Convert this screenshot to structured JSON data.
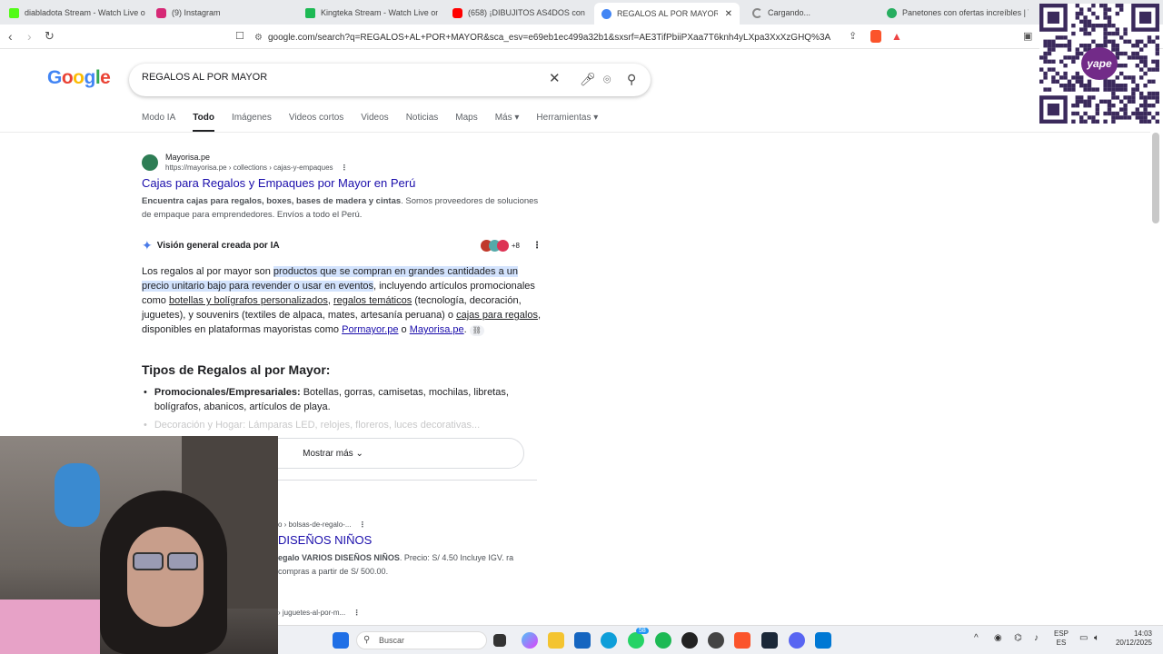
{
  "browser": {
    "tabs": [
      {
        "label": "diabladota Stream - Watch Live on Ki"
      },
      {
        "label": "(9) Instagram"
      },
      {
        "label": "Kingteka Stream - Watch Live on Kic"
      },
      {
        "label": "(658) ¡DIBUJITOS AS4DOS con Vi"
      },
      {
        "label": "REGALOS AL POR MAYOR - Busc"
      },
      {
        "label": "Cargando..."
      },
      {
        "label": "Panetones con ofertas increíbles | To"
      }
    ],
    "url": "google.com/search?q=REGALOS+AL+POR+MAYOR&sca_esv=e69eb1ec499a32b1&sxsrf=AE3TifPbiiPXaa7T6knh4yLXpa3XxXzGHQ%3A17662572092..."
  },
  "logo": {
    "text": "Google"
  },
  "search": {
    "query": "REGALOS AL POR MAYOR"
  },
  "nav_tabs": [
    "Modo IA",
    "Todo",
    "Imágenes",
    "Videos cortos",
    "Videos",
    "Noticias",
    "Maps",
    "Más ▾",
    "Herramientas ▾"
  ],
  "result1": {
    "site": "Mayorisa.pe",
    "url": "https://mayorisa.pe › collections › cajas-y-empaques",
    "title": "Cajas para Regalos y Empaques por Mayor en Perú",
    "snippet_bold": "Encuentra cajas para regalos, boxes, bases de madera y cintas",
    "snippet_rest": ". Somos proveedores de soluciones de empaque para emprendedores. Envíos a todo el Perú."
  },
  "ai_overview": {
    "heading": "Visión general creada por IA",
    "source_count": "+8",
    "p1_a": "Los regalos al por mayor son ",
    "p1_hl": "productos que se compran en grandes cantidades a un precio unitario bajo para revender o usar en eventos",
    "p1_b": ", incluyendo artículos promocionales como ",
    "p1_l1": "botellas y bolígrafos personalizados",
    "p1_c": ", ",
    "p1_l2": "regalos temáticos",
    "p1_d": " (tecnología, decoración, juguetes), y souvenirs (textiles de alpaca, mates, artesanía peruana) o ",
    "p1_l3": "cajas para regalos",
    "p1_e": ", disponibles en plataformas mayoristas como ",
    "p1_l4": "Pormayor.pe",
    "p1_f": " o ",
    "p1_l5": "Mayorisa.pe",
    "p1_g": ".",
    "h2": "Tipos de Regalos al por Mayor:",
    "li1_bold": "Promocionales/Empresariales:",
    "li1_rest": " Botellas, gorras, camisetas, mochilas, libretas, bolígrafos, abanicos, artículos de playa.",
    "li2_faded": "Decoración y Hogar: Lámparas LED, relojes, floreros, luces decorativas...",
    "show_more": "Mostrar más"
  },
  "result2": {
    "url": "o › bolsas-de-regalo-...",
    "title": "DISEÑOS NIÑOS",
    "snippet_bold": "egalo VARIOS DISEÑOS NIÑOS",
    "snippet_rest": ". Precio: S/ 4.50 Incluye IGV. ra compras a partir de S/ 500.00."
  },
  "result3": {
    "url": "› juguetes-al-por-m..."
  },
  "taskbar": {
    "search_placeholder": "Buscar",
    "lang1": "ESP",
    "lang2": "ES",
    "time": "14:03",
    "date": "20/12/2025",
    "badge": "58"
  },
  "overlay": {
    "qr_label": "yape"
  },
  "colors": {
    "link": "#1a0dab",
    "highlight": "#d3e3fd",
    "accent_blue": "#4285f4"
  }
}
